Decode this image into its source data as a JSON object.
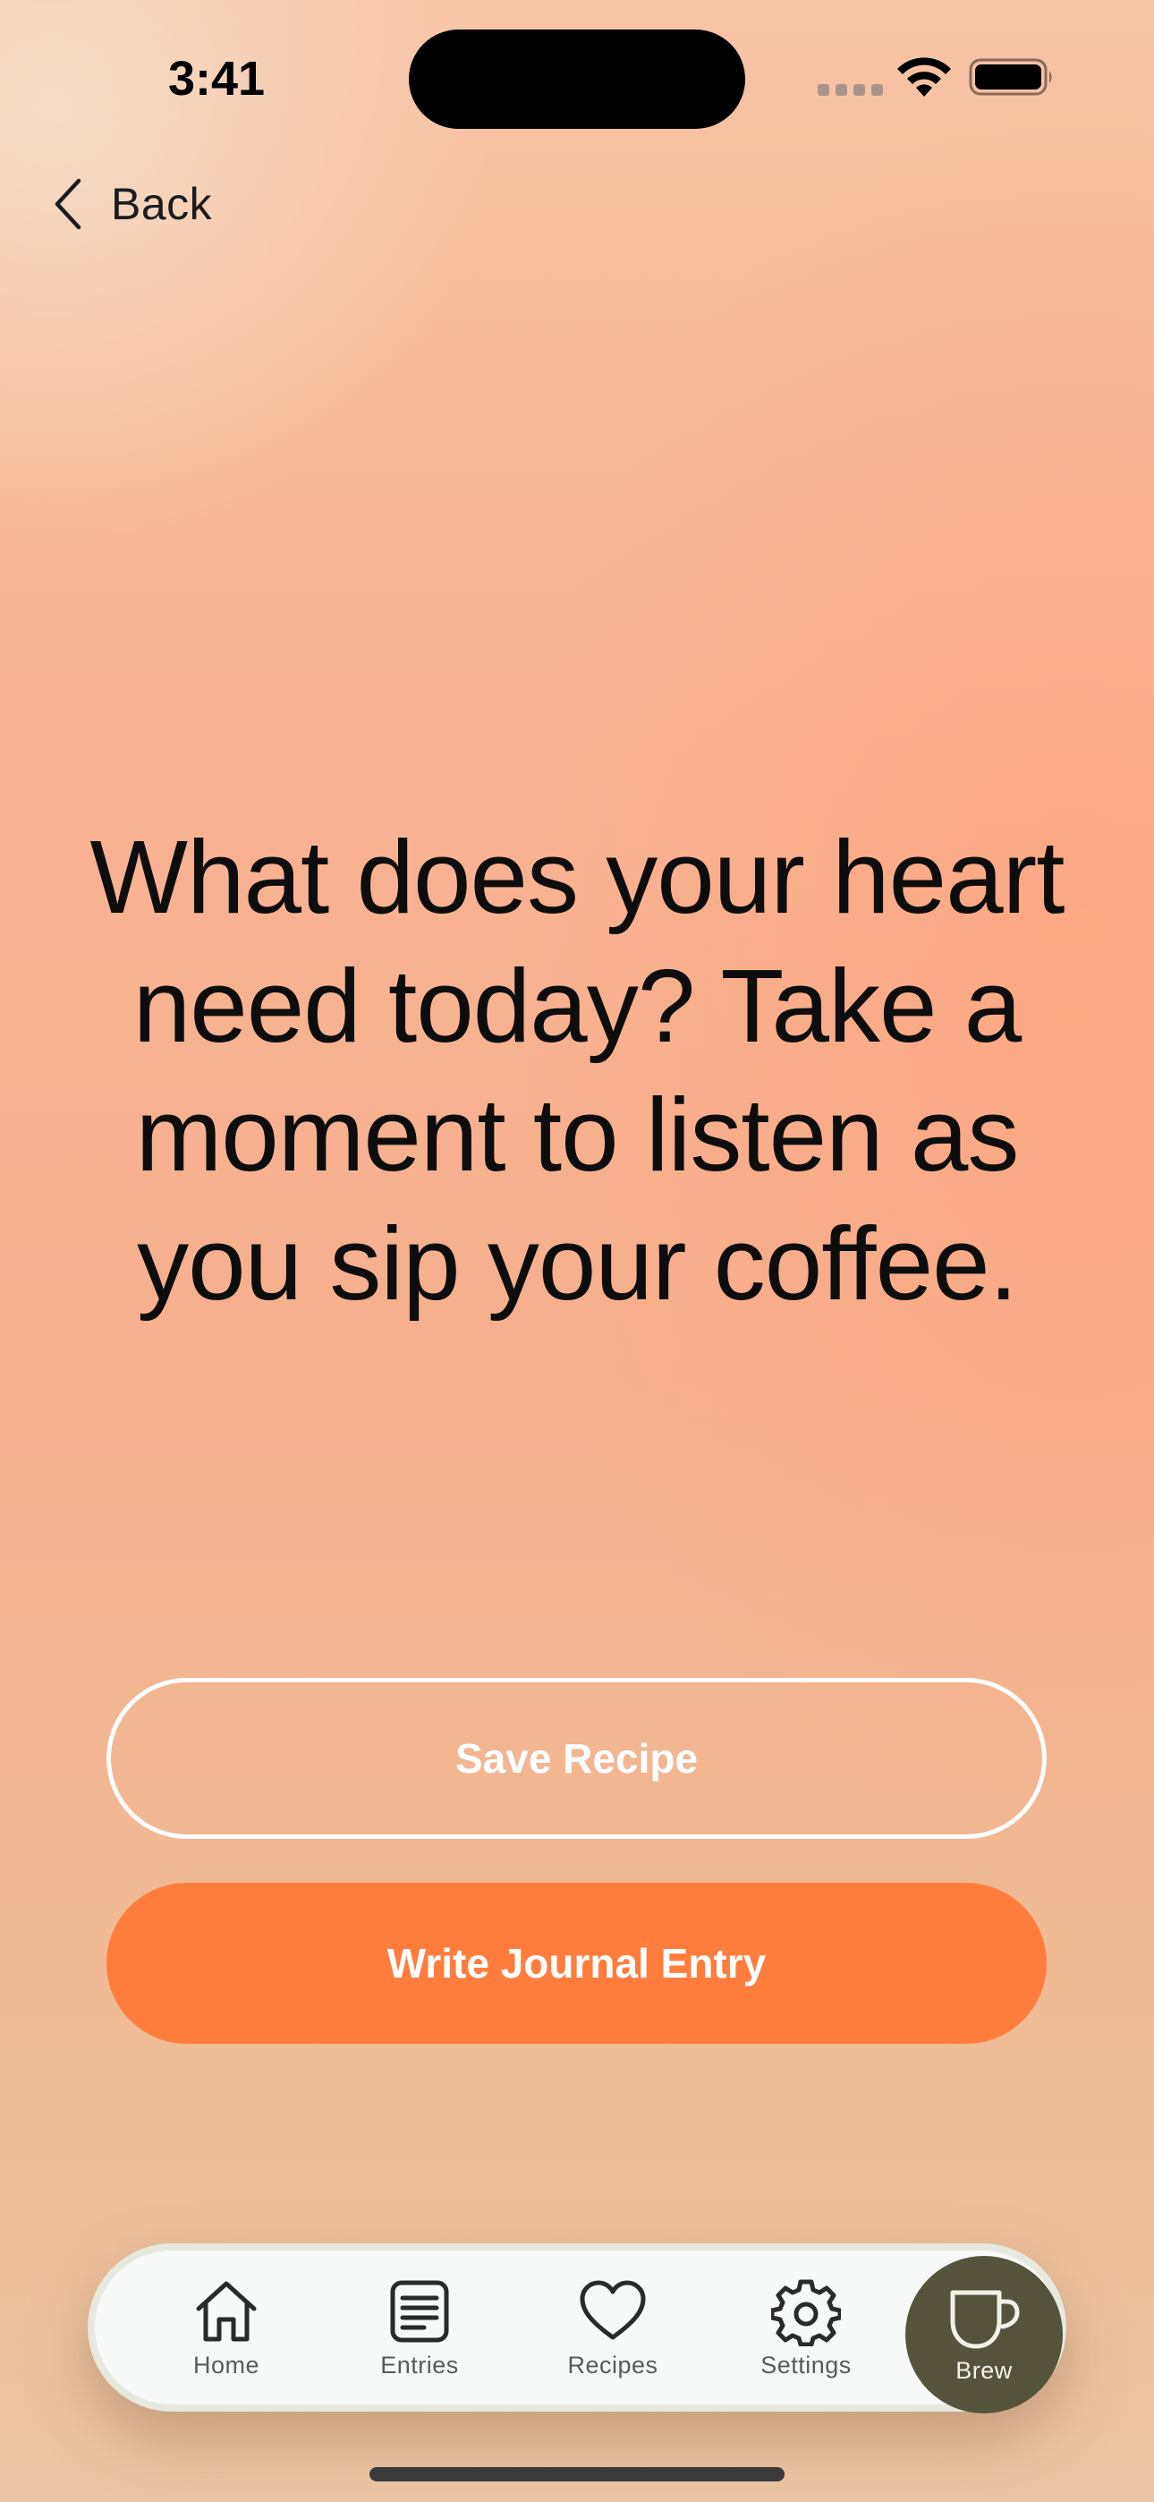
{
  "status_bar": {
    "time": "3:41"
  },
  "nav": {
    "back_label": "Back"
  },
  "prompt": {
    "text": "What does your heart need today? Take a moment to listen as you sip your coffee."
  },
  "actions": {
    "save_recipe": "Save Recipe",
    "write_journal": "Write Journal Entry"
  },
  "tab_bar": {
    "tabs": [
      {
        "label": "Home",
        "icon": "home-icon"
      },
      {
        "label": "Entries",
        "icon": "entries-icon"
      },
      {
        "label": "Recipes",
        "icon": "heart-icon"
      },
      {
        "label": "Settings",
        "icon": "gear-icon"
      },
      {
        "label": "Brew",
        "icon": "cup-icon",
        "active": true
      }
    ]
  },
  "colors": {
    "accent": "#ff7d3c",
    "brew_active": "#55543b"
  }
}
